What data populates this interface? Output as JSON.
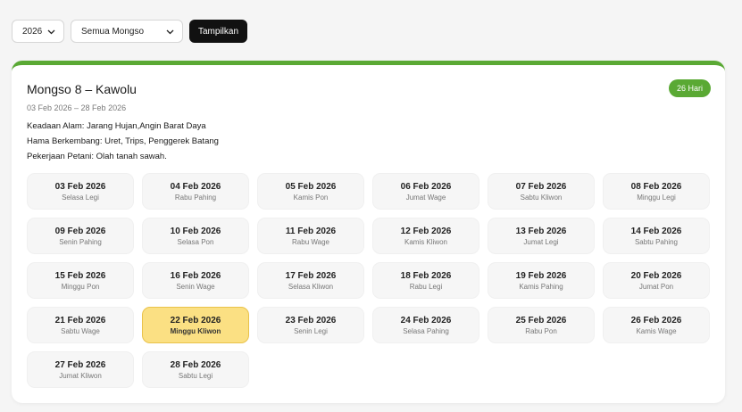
{
  "filters": {
    "year_value": "2026",
    "mongso_value": "Semua Mongso",
    "submit_label": "Tampilkan"
  },
  "card": {
    "title": "Mongso 8 – Kawolu",
    "badge": "26 Hari",
    "range": "03 Feb 2026 – 28 Feb 2026",
    "alam_label": "Keadaan Alam:",
    "alam_value": " Jarang Hujan,Angin Barat Daya",
    "hama_label": "Hama Berkembang:",
    "hama_value": " Uret, Trips, Penggerek Batang",
    "kerja_label": "Pekerjaan Petani:",
    "kerja_value": " Olah tanah sawah.",
    "accent_color": "#5aa934",
    "highlight_color": "#fbe083"
  },
  "days": [
    {
      "date": "03 Feb 2026",
      "pasaran": "Selasa Legi"
    },
    {
      "date": "04 Feb 2026",
      "pasaran": "Rabu Pahing"
    },
    {
      "date": "05 Feb 2026",
      "pasaran": "Kamis Pon"
    },
    {
      "date": "06 Feb 2026",
      "pasaran": "Jumat Wage"
    },
    {
      "date": "07 Feb 2026",
      "pasaran": "Sabtu Kliwon"
    },
    {
      "date": "08 Feb 2026",
      "pasaran": "Minggu Legi"
    },
    {
      "date": "09 Feb 2026",
      "pasaran": "Senin Pahing"
    },
    {
      "date": "10 Feb 2026",
      "pasaran": "Selasa Pon"
    },
    {
      "date": "11 Feb 2026",
      "pasaran": "Rabu Wage"
    },
    {
      "date": "12 Feb 2026",
      "pasaran": "Kamis Kliwon"
    },
    {
      "date": "13 Feb 2026",
      "pasaran": "Jumat Legi"
    },
    {
      "date": "14 Feb 2026",
      "pasaran": "Sabtu Pahing"
    },
    {
      "date": "15 Feb 2026",
      "pasaran": "Minggu Pon"
    },
    {
      "date": "16 Feb 2026",
      "pasaran": "Senin Wage"
    },
    {
      "date": "17 Feb 2026",
      "pasaran": "Selasa Kliwon"
    },
    {
      "date": "18 Feb 2026",
      "pasaran": "Rabu Legi"
    },
    {
      "date": "19 Feb 2026",
      "pasaran": "Kamis Pahing"
    },
    {
      "date": "20 Feb 2026",
      "pasaran": "Jumat Pon"
    },
    {
      "date": "21 Feb 2026",
      "pasaran": "Sabtu Wage"
    },
    {
      "date": "22 Feb 2026",
      "pasaran": "Minggu Kliwon",
      "active": true
    },
    {
      "date": "23 Feb 2026",
      "pasaran": "Senin Legi"
    },
    {
      "date": "24 Feb 2026",
      "pasaran": "Selasa Pahing"
    },
    {
      "date": "25 Feb 2026",
      "pasaran": "Rabu Pon"
    },
    {
      "date": "26 Feb 2026",
      "pasaran": "Kamis Wage"
    },
    {
      "date": "27 Feb 2026",
      "pasaran": "Jumat Kliwon"
    },
    {
      "date": "28 Feb 2026",
      "pasaran": "Sabtu Legi"
    }
  ]
}
